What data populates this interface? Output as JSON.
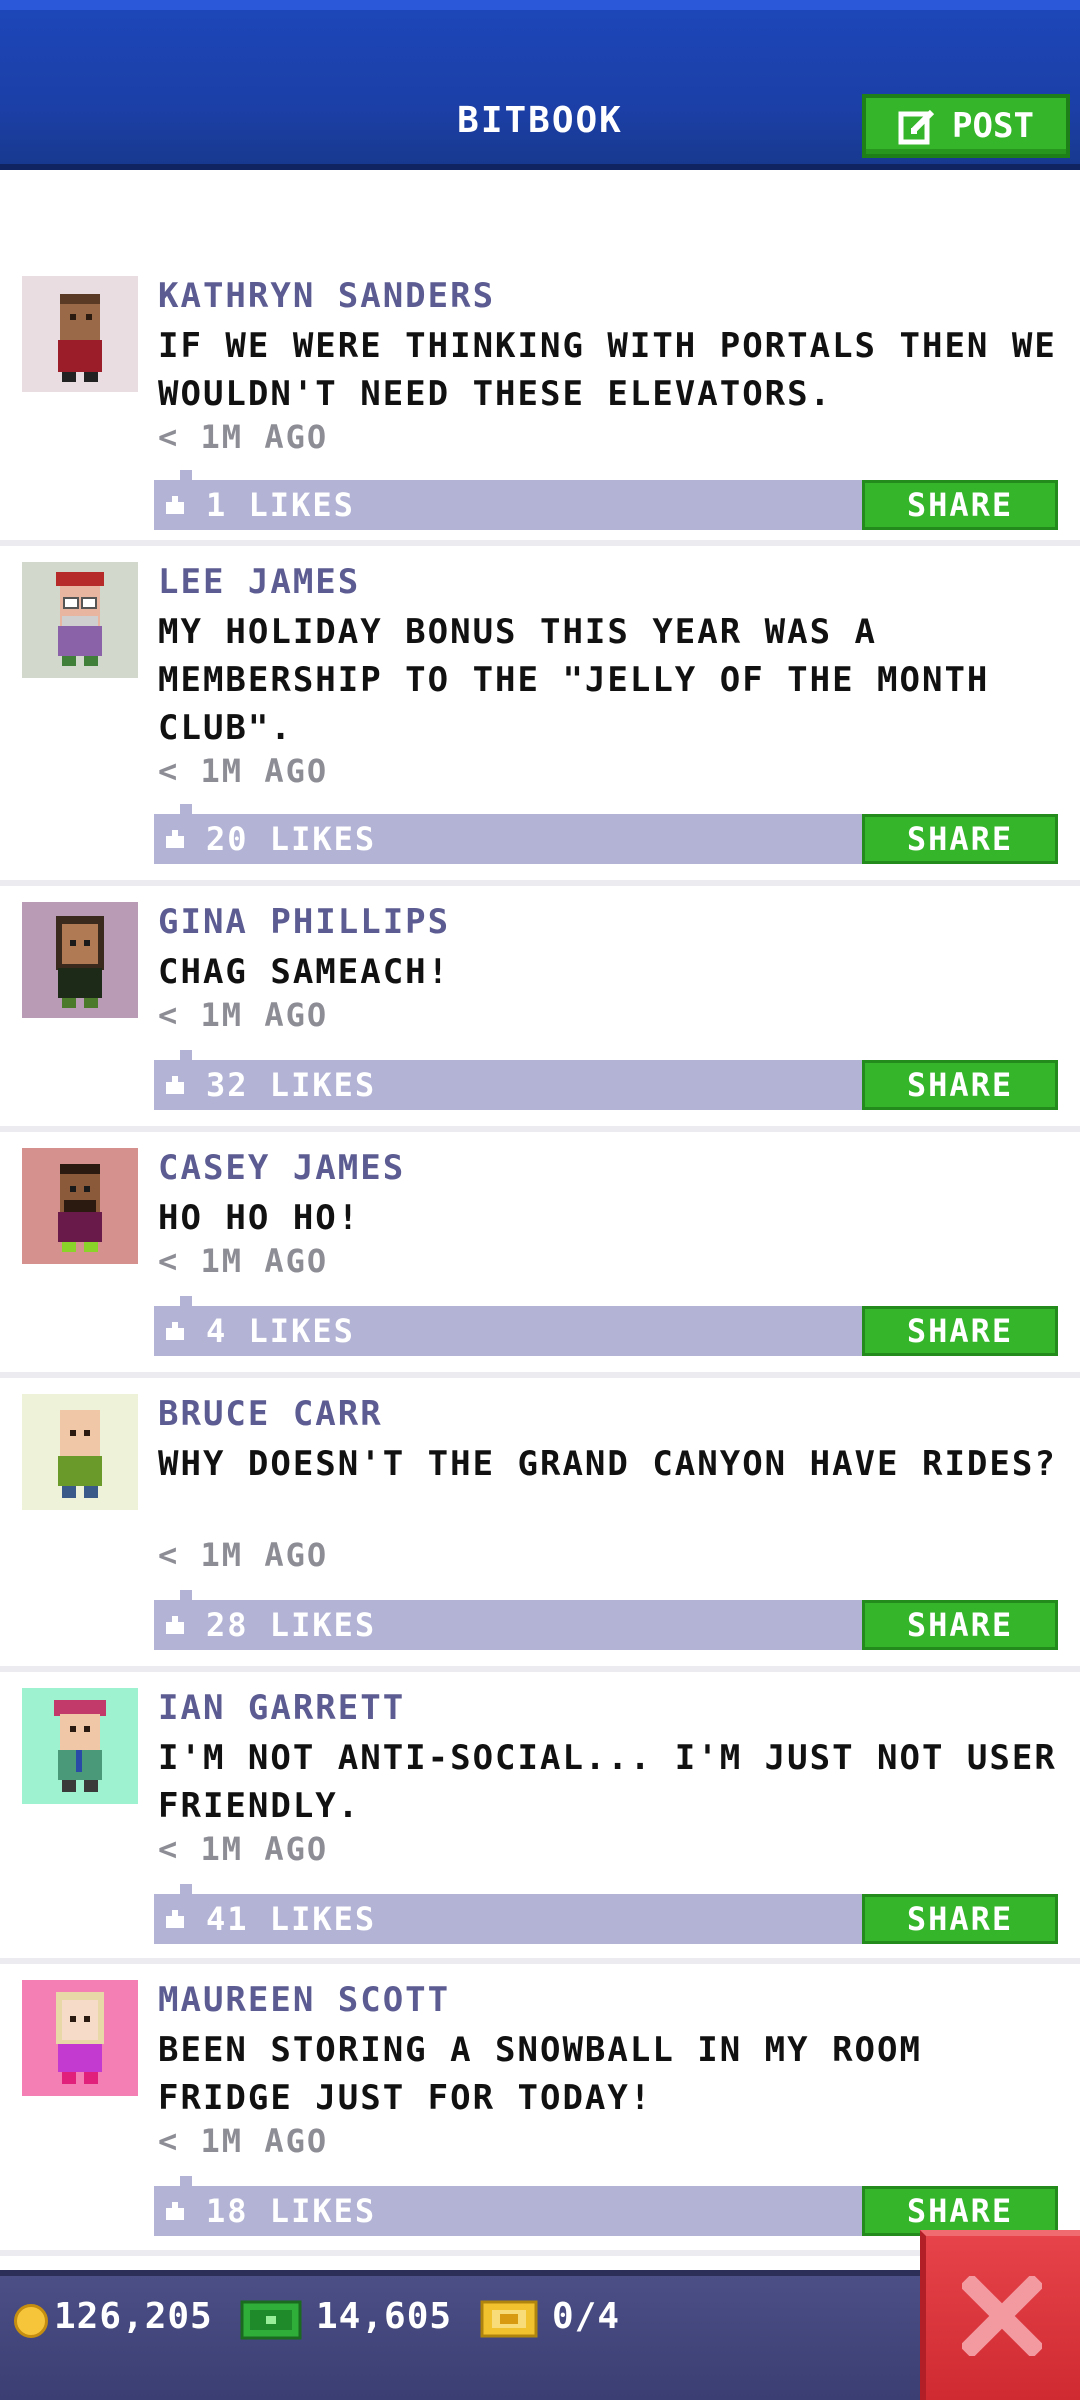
{
  "header": {
    "title": "BITBOOK",
    "post_label": "POST"
  },
  "posts": [
    {
      "author": "KATHRYN SANDERS",
      "text": "IF WE WERE THINKING WITH PORTALS THEN WE WOULDN'T NEED THESE ELEVATORS.",
      "time": "< 1M AGO",
      "likes": "1 LIKES",
      "share_label": "SHARE",
      "avatar_bg": "#eadde2"
    },
    {
      "author": "LEE JAMES",
      "text": "MY HOLIDAY BONUS THIS YEAR WAS A MEMBERSHIP TO THE \"JELLY OF THE MONTH CLUB\".",
      "time": "< 1M AGO",
      "likes": "20 LIKES",
      "share_label": "SHARE",
      "avatar_bg": "#d3d8cc"
    },
    {
      "author": "GINA PHILLIPS",
      "text": "CHAG SAMEACH!",
      "time": "< 1M AGO",
      "likes": "32 LIKES",
      "share_label": "SHARE",
      "avatar_bg": "#b99bb6"
    },
    {
      "author": "CASEY JAMES",
      "text": "HO HO HO!",
      "time": "< 1M AGO",
      "likes": "4 LIKES",
      "share_label": "SHARE",
      "avatar_bg": "#d4918d"
    },
    {
      "author": "BRUCE CARR",
      "text": "WHY DOESN'T THE GRAND CANYON HAVE RIDES?",
      "time": "< 1M AGO",
      "likes": "28 LIKES",
      "share_label": "SHARE",
      "avatar_bg": "#eef2d9"
    },
    {
      "author": "IAN GARRETT",
      "text": "I'M NOT ANTI-SOCIAL... I'M JUST NOT USER FRIENDLY.",
      "time": "< 1M AGO",
      "likes": "41 LIKES",
      "share_label": "SHARE",
      "avatar_bg": "#9ef2cf"
    },
    {
      "author": "MAUREEN SCOTT",
      "text": "BEEN STORING A SNOWBALL IN MY ROOM FRIDGE JUST FOR TODAY!",
      "time": "< 1M AGO",
      "likes": "18 LIKES",
      "share_label": "SHARE",
      "avatar_bg": "#f47fb5"
    }
  ],
  "footer": {
    "coins": "126,205",
    "bux": "14,605",
    "tickets": "0/4"
  },
  "colors": {
    "header_blue": "#1b3fa6",
    "accent_green": "#35b62a",
    "likes_bar": "#b3b3d6",
    "author_text": "#5c5c93",
    "close_red": "#d9343b"
  }
}
